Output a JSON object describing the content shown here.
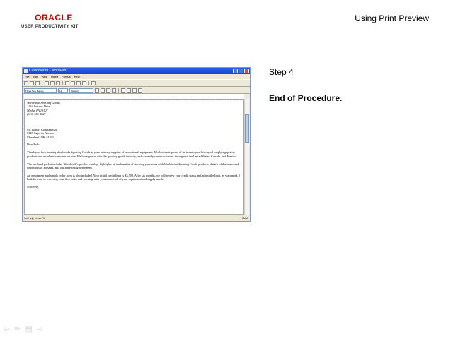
{
  "logo": {
    "brand": "ORACLE",
    "subtitle": "USER PRODUCTIVITY KIT"
  },
  "page_title": "Using Print Preview",
  "step": {
    "label": "Step 4",
    "message": "End of Procedure."
  },
  "wordpad": {
    "title": "Customer.rtf - WordPad",
    "menu": [
      "File",
      "Edit",
      "View",
      "Insert",
      "Format",
      "Help"
    ],
    "font_name": "Times New Roman",
    "font_size": "12",
    "script": "Western",
    "status_text": "For Help, press F1",
    "status_num": "NUM",
    "doc_header": "Worldwide Sporting Goods\n1234 Leisure Drive\nMedia, PA 19107\n(610) 555-4321",
    "doc_body": "\n\n\n\nMr. Robert Campanellas\n5325 Superior Avenue\nCleveland, OH  44103\n\nDear Rob:\n\nThank you for choosing Worldwide Sporting Goods as your primary supplier of recreational equipment. Worldwide is proud of its twenty-year history of supplying quality products and excellent customer service. We have grown with the sporting goods industry, and currently serve customers throughout the United States, Canada, and Mexico.\n\nThe enclosed packet includes Worldwide's product catalog, highlights of the benefits of stocking your store with Worldwide Sporting Goods products, details of the terms and conditions of all sales, and our advertising agreement.\n\nAn equipment and supply order form is also included. Your initial credit limit is $3,500. After six months, we will review your credit status and adjust the limit, as warranted. I look forward to receiving your first order and working with you to meet all of your equipment and supply needs.\n\nSincerely,"
  },
  "icons": {
    "nav_back": "back-arrow-icon",
    "nav_pen": "pen-icon",
    "nav_menu": "menu-icon",
    "nav_forward": "forward-arrow-icon"
  },
  "colors": {
    "oracle_red": "#d00000",
    "titlebar_blue": "#2a5ee8"
  }
}
